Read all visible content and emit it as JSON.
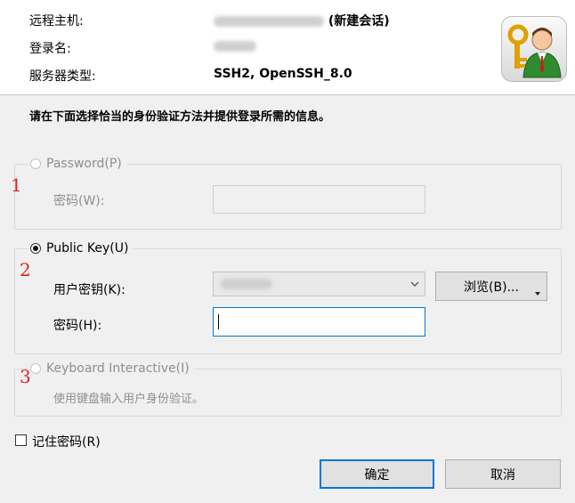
{
  "header": {
    "remote_host_label": "远程主机:",
    "remote_host_suffix": "(新建会话)",
    "login_name_label": "登录名:",
    "server_type_label": "服务器类型:",
    "server_type_value": "SSH2, OpenSSH_8.0"
  },
  "instruction": "请在下面选择恰当的身份验证方法并提供登录所需的信息。",
  "password_group": {
    "radio_label": "Password(P)",
    "field_label": "密码(W):",
    "marker": "1",
    "selected": false,
    "enabled": false
  },
  "publickey_group": {
    "radio_label": "Public Key(U)",
    "user_key_label": "用户密钥(K):",
    "browse_label": "浏览(B)...",
    "password_label": "密码(H):",
    "marker": "2",
    "selected": true
  },
  "keyboard_group": {
    "radio_label": "Keyboard Interactive(I)",
    "description": "使用键盘输入用户身份验证。",
    "marker": "3",
    "selected": false,
    "enabled": false
  },
  "remember_password": {
    "label": "记住密码(R)",
    "checked": false
  },
  "buttons": {
    "ok": "确定",
    "cancel": "取消"
  },
  "colors": {
    "accent": "#0078d7",
    "marker": "#e02020",
    "background": "#f0f0f0"
  },
  "icon": "user-key-icon"
}
